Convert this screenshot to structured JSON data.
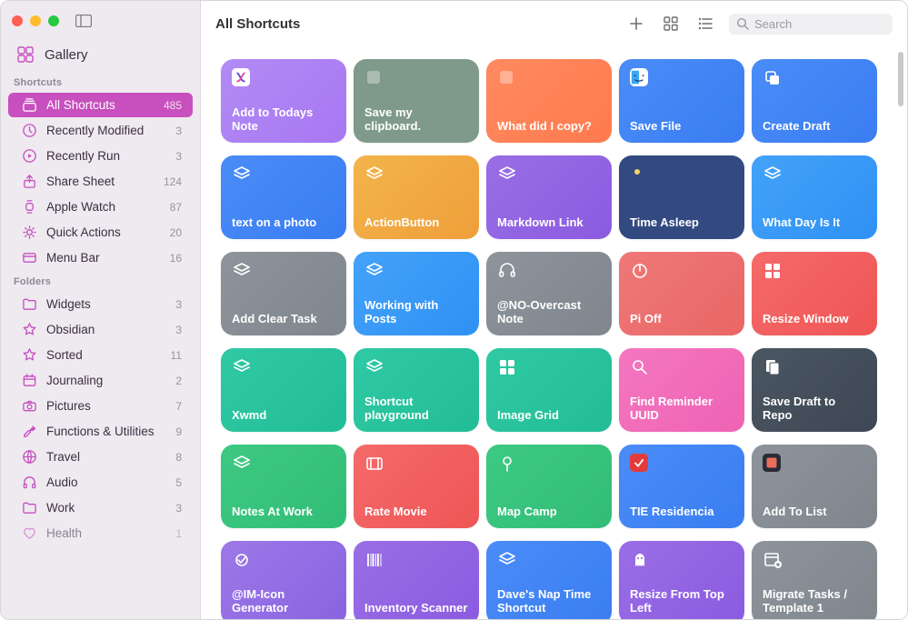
{
  "header": {
    "title": "All Shortcuts",
    "search_placeholder": "Search"
  },
  "sidebar": {
    "gallery": "Gallery",
    "section_shortcuts": "Shortcuts",
    "section_folders": "Folders",
    "shortcuts": [
      {
        "label": "All Shortcuts",
        "count": "485",
        "icon": "stack"
      },
      {
        "label": "Recently Modified",
        "count": "3",
        "icon": "clock"
      },
      {
        "label": "Recently Run",
        "count": "3",
        "icon": "play"
      },
      {
        "label": "Share Sheet",
        "count": "124",
        "icon": "share"
      },
      {
        "label": "Apple Watch",
        "count": "87",
        "icon": "watch"
      },
      {
        "label": "Quick Actions",
        "count": "20",
        "icon": "gear"
      },
      {
        "label": "Menu Bar",
        "count": "16",
        "icon": "menubar"
      }
    ],
    "folders": [
      {
        "label": "Widgets",
        "count": "3",
        "icon": "folder"
      },
      {
        "label": "Obsidian",
        "count": "3",
        "icon": "star"
      },
      {
        "label": "Sorted",
        "count": "11",
        "icon": "star"
      },
      {
        "label": "Journaling",
        "count": "2",
        "icon": "calendar"
      },
      {
        "label": "Pictures",
        "count": "7",
        "icon": "camera"
      },
      {
        "label": "Functions & Utilities",
        "count": "9",
        "icon": "wrench"
      },
      {
        "label": "Travel",
        "count": "8",
        "icon": "globe"
      },
      {
        "label": "Audio",
        "count": "5",
        "icon": "headphones"
      },
      {
        "label": "Work",
        "count": "3",
        "icon": "folder"
      },
      {
        "label": "Health",
        "count": "1",
        "icon": "heart"
      }
    ]
  },
  "tiles": [
    {
      "label": "Add to Todays Note",
      "color": "grad-purple",
      "icon": "app-box"
    },
    {
      "label": "Save my clipboard.",
      "color": "seafoam",
      "icon": "square"
    },
    {
      "label": "What did I copy?",
      "color": "orange",
      "icon": "square"
    },
    {
      "label": "Save File",
      "color": "blue",
      "icon": "finder"
    },
    {
      "label": "Create Draft",
      "color": "blue",
      "icon": "copy"
    },
    {
      "label": "text on a photo",
      "color": "blue",
      "icon": "layers"
    },
    {
      "label": "ActionButton",
      "color": "amber",
      "icon": "layers"
    },
    {
      "label": "Markdown Link",
      "color": "violet",
      "icon": "layers"
    },
    {
      "label": "Time Asleep",
      "color": "navy",
      "icon": "moon"
    },
    {
      "label": "What Day Is It",
      "color": "blue2",
      "icon": "layers"
    },
    {
      "label": "Add Clear Task",
      "color": "grey",
      "icon": "layers"
    },
    {
      "label": "Working with Posts",
      "color": "blue2",
      "icon": "layers"
    },
    {
      "label": "@NO-Overcast Note",
      "color": "grey",
      "icon": "headphones"
    },
    {
      "label": "Pi Off",
      "color": "redsoft",
      "icon": "power"
    },
    {
      "label": "Resize Window",
      "color": "red",
      "icon": "grid"
    },
    {
      "label": "Xwmd",
      "color": "teal",
      "icon": "layers"
    },
    {
      "label": "Shortcut playground",
      "color": "teal",
      "icon": "layers"
    },
    {
      "label": "Image Grid",
      "color": "teal",
      "icon": "grid"
    },
    {
      "label": "Find Reminder UUID",
      "color": "pink",
      "icon": "search"
    },
    {
      "label": "Save Draft to Repo",
      "color": "dark",
      "icon": "docs"
    },
    {
      "label": "Notes At Work",
      "color": "green",
      "icon": "layers"
    },
    {
      "label": "Rate Movie",
      "color": "red",
      "icon": "film"
    },
    {
      "label": "Map Camp",
      "color": "green",
      "icon": "pin"
    },
    {
      "label": "TIE Residencia",
      "color": "blue",
      "icon": "app-red"
    },
    {
      "label": "Add To List",
      "color": "grey",
      "icon": "app-box2"
    },
    {
      "label": "@IM-Icon Generator",
      "color": "grad-purple2",
      "icon": "wand"
    },
    {
      "label": "Inventory Scanner",
      "color": "violet",
      "icon": "barcode"
    },
    {
      "label": "Dave's Nap Time Shortcut",
      "color": "blue",
      "icon": "layers"
    },
    {
      "label": "Resize From Top Left",
      "color": "violet",
      "icon": "ghost"
    },
    {
      "label": "Migrate Tasks / Template 1",
      "color": "grey",
      "icon": "cal-plus"
    }
  ]
}
